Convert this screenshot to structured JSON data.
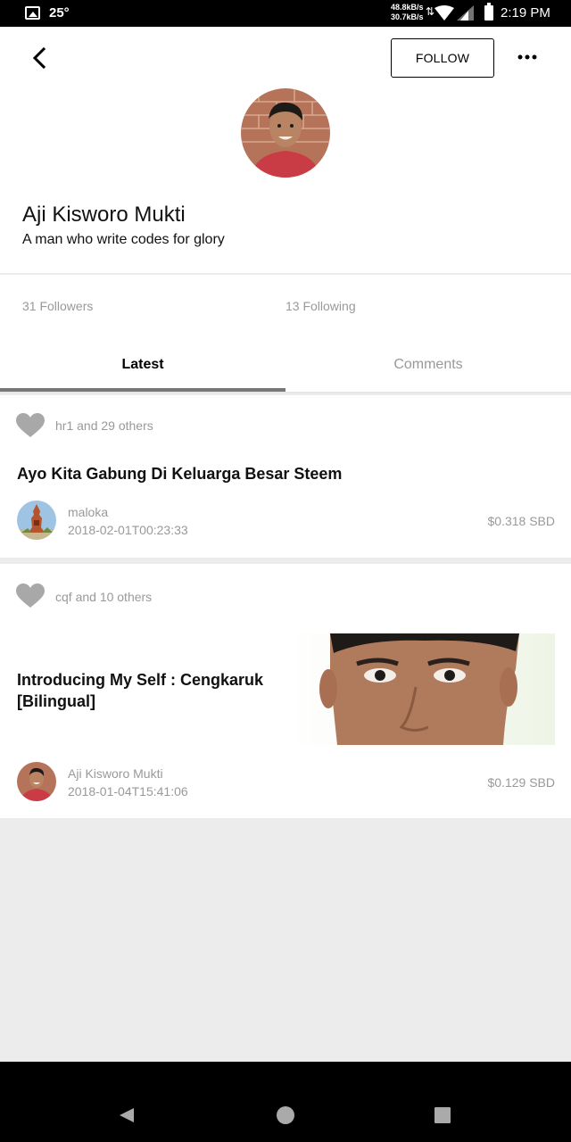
{
  "status_bar": {
    "temperature": "25°",
    "speed_up": "48.8kB/s",
    "speed_down": "30.7kB/s",
    "time": "2:19 PM"
  },
  "profile": {
    "follow_label": "FOLLOW",
    "name": "Aji Kisworo Mukti",
    "bio": "A man who write codes for glory",
    "followers": "31 Followers",
    "following": "13 Following"
  },
  "tabs": [
    {
      "label": "Latest",
      "active": true
    },
    {
      "label": "Comments",
      "active": false
    }
  ],
  "posts": [
    {
      "voters": "hr1 and 29 others",
      "title": "Ayo Kita Gabung Di Keluarga Besar Steem",
      "author": "maloka",
      "date": "2018-02-01T00:23:33",
      "payout": "$0.318 SBD"
    },
    {
      "voters": "cqf and 10 others",
      "title": "Introducing My Self : Cengkaruk [Bilingual]",
      "author": "Aji Kisworo Mukti",
      "date": "2018-01-04T15:41:06",
      "payout": "$0.129 SBD"
    }
  ],
  "colors": {
    "background": "#ececec",
    "tab_indicator": "#777777",
    "muted_text": "#999999",
    "heart": "#a8a8a8"
  }
}
